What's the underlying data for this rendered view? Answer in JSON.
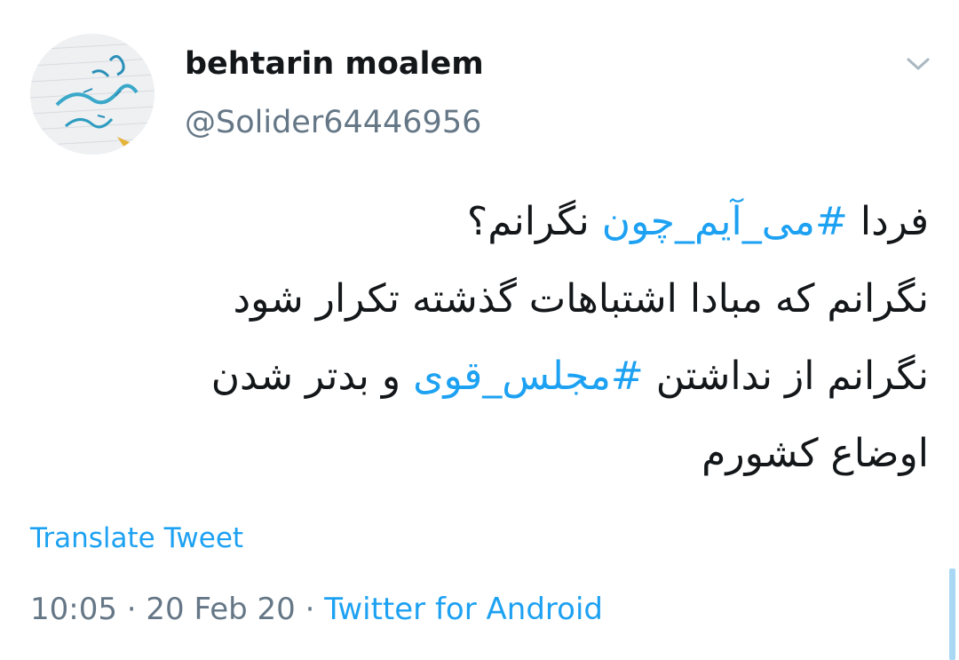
{
  "tweet": {
    "display_name": "behtarin moalem",
    "handle": "@Solider64446956",
    "lines": [
      [
        {
          "text": "فردا ",
          "hashtag": false
        },
        {
          "text": "#می_آیم_چون",
          "hashtag": true
        },
        {
          "text": " نگرانم؟",
          "hashtag": false
        }
      ],
      [
        {
          "text": "نگرانم که مبادا اشتباهات گذشته تکرار شود",
          "hashtag": false
        }
      ],
      [
        {
          "text": "نگرانم از نداشتن ",
          "hashtag": false
        },
        {
          "text": "#مجلس_قوی",
          "hashtag": true
        },
        {
          "text": " و بدتر شدن",
          "hashtag": false
        }
      ],
      [
        {
          "text": "اوضاع کشورم",
          "hashtag": false
        }
      ]
    ],
    "translate_label": "Translate Tweet",
    "time": "10:05",
    "separator": "·",
    "date": "20 Feb 20",
    "source": "Twitter for Android"
  },
  "icons": {
    "caret": "chevron-down-icon",
    "avatar": "avatar-image"
  },
  "colors": {
    "link": "#1da1f2",
    "text": "#14171a",
    "secondary": "#657786",
    "scrollbar": "#a9d8f5"
  }
}
